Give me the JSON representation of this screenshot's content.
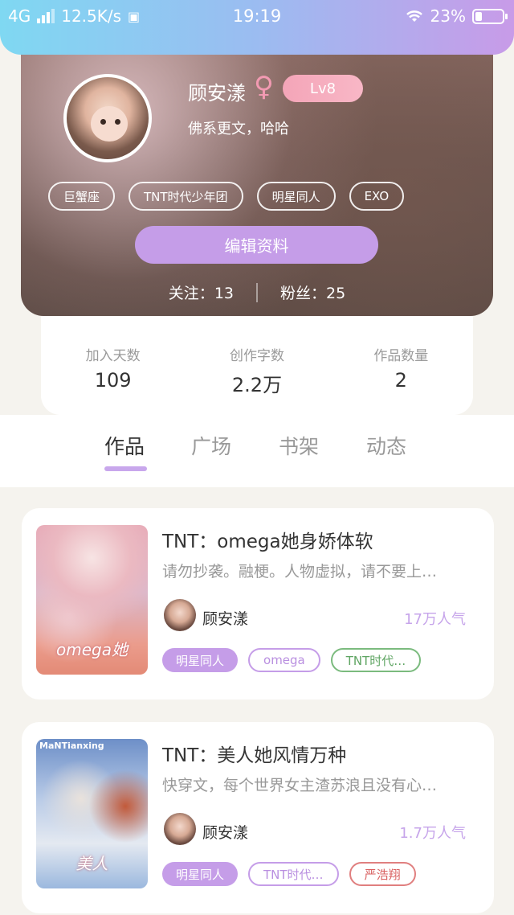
{
  "status_bar": {
    "network": "4G",
    "speed": "12.5K/s",
    "time": "19:19",
    "battery": "23%"
  },
  "profile": {
    "name": "顾安漾",
    "gender_symbol": "♀",
    "level": "Lv8",
    "bio": "佛系更文，哈哈",
    "tags": [
      "巨蟹座",
      "TNT时代少年团",
      "明星同人",
      "EXO"
    ],
    "edit_label": "编辑资料",
    "following_label": "关注：",
    "following": "13",
    "followers_label": "粉丝：",
    "followers": "25"
  },
  "stats": [
    {
      "label": "加入天数",
      "value": "109"
    },
    {
      "label": "创作字数",
      "value": "2.2万"
    },
    {
      "label": "作品数量",
      "value": "2"
    }
  ],
  "tabs": [
    "作品",
    "广场",
    "书架",
    "动态"
  ],
  "works": [
    {
      "title": "TNT：omega她身娇体软",
      "desc": "请勿抄袭。融梗。人物虚拟，请不要上…",
      "author": "顾安漾",
      "popularity": "17万人气",
      "cover_text": "omega她",
      "tags": [
        {
          "label": "明星同人",
          "style": "fill"
        },
        {
          "label": "omega",
          "style": "purple"
        },
        {
          "label": "TNT时代…",
          "style": "green"
        }
      ]
    },
    {
      "title": "TNT：美人她风情万种",
      "desc": "快穿文，每个世界女主渣苏浪且没有心…",
      "author": "顾安漾",
      "popularity": "1.7万人气",
      "cover_top": "MaNTianxing",
      "cover_text": "美人",
      "tags": [
        {
          "label": "明星同人",
          "style": "fill"
        },
        {
          "label": "TNT时代…",
          "style": "purple"
        },
        {
          "label": "严浩翔",
          "style": "red"
        }
      ]
    }
  ]
}
